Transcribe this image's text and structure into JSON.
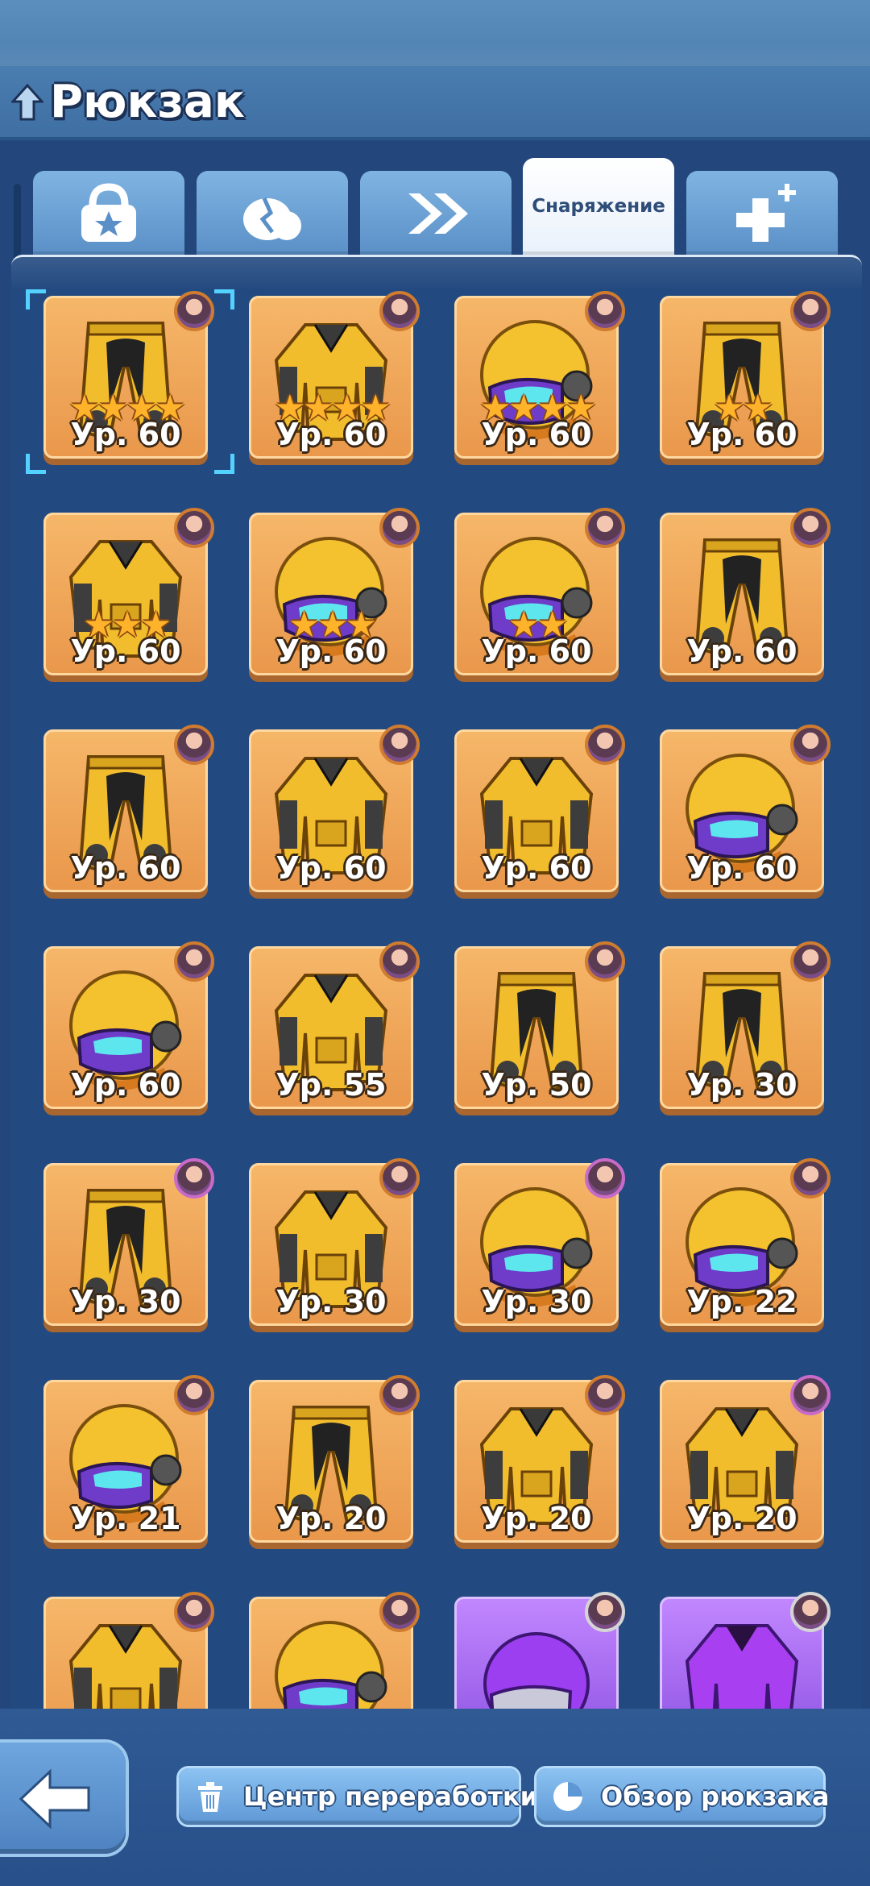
{
  "header": {
    "title": "Рюкзак",
    "icon": "up-arrow-icon"
  },
  "tabs": [
    {
      "name": "tab-items",
      "icon": "bag-icon"
    },
    {
      "name": "tab-shards",
      "icon": "shard-icon"
    },
    {
      "name": "tab-boost",
      "icon": "double-chevron-icon"
    },
    {
      "name": "tab-equipment",
      "label": "Снаряжение",
      "active": true
    },
    {
      "name": "tab-plus",
      "icon": "plus-icon"
    }
  ],
  "items": [
    {
      "type": "pants",
      "stars": 4,
      "level": "Ур. 60",
      "selected": true
    },
    {
      "type": "jacket",
      "stars": 4,
      "level": "Ур. 60"
    },
    {
      "type": "helmet",
      "stars": 4,
      "level": "Ур. 60"
    },
    {
      "type": "pants",
      "stars": 2,
      "level": "Ур. 60"
    },
    {
      "type": "jacket",
      "stars": 3,
      "level": "Ур. 60"
    },
    {
      "type": "helmet",
      "stars": 3,
      "level": "Ур. 60"
    },
    {
      "type": "helmet",
      "stars": 2,
      "level": "Ур. 60"
    },
    {
      "type": "pants",
      "stars": 0,
      "level": "Ур. 60"
    },
    {
      "type": "pants",
      "stars": 0,
      "level": "Ур. 60"
    },
    {
      "type": "jacket",
      "stars": 0,
      "level": "Ур. 60"
    },
    {
      "type": "jacket",
      "stars": 0,
      "level": "Ур. 60"
    },
    {
      "type": "helmet",
      "stars": 0,
      "level": "Ур. 60"
    },
    {
      "type": "helmet",
      "stars": 0,
      "level": "Ур. 60"
    },
    {
      "type": "jacket",
      "stars": 0,
      "level": "Ур. 55"
    },
    {
      "type": "pants",
      "stars": 0,
      "level": "Ур. 50"
    },
    {
      "type": "pants",
      "stars": 0,
      "level": "Ур. 30"
    },
    {
      "type": "pants",
      "stars": 0,
      "level": "Ур. 30",
      "avatar": "pink"
    },
    {
      "type": "jacket",
      "stars": 0,
      "level": "Ур. 30"
    },
    {
      "type": "helmet",
      "stars": 0,
      "level": "Ур. 30",
      "avatar": "pink"
    },
    {
      "type": "helmet",
      "stars": 0,
      "level": "Ур. 22"
    },
    {
      "type": "helmet",
      "stars": 0,
      "level": "Ур. 21"
    },
    {
      "type": "pants",
      "stars": 0,
      "level": "Ур. 20"
    },
    {
      "type": "jacket",
      "stars": 0,
      "level": "Ур. 20"
    },
    {
      "type": "jacket",
      "stars": 0,
      "level": "Ур. 20",
      "avatar": "pink"
    },
    {
      "type": "jacket",
      "stars": 0,
      "level": ""
    },
    {
      "type": "helmet",
      "stars": 0,
      "level": ""
    },
    {
      "type": "helmet",
      "stars": 0,
      "level": "",
      "rarity": "purple",
      "avatar": "white"
    },
    {
      "type": "jacket",
      "stars": 0,
      "level": "",
      "rarity": "purple",
      "avatar": "white"
    }
  ],
  "bottom": {
    "back_icon": "back-arrow-icon",
    "recycle_label": "Центр переработки",
    "recycle_icon": "trash-icon",
    "overview_label": "Обзор рюкзака",
    "overview_icon": "pie-chart-icon"
  },
  "colors": {
    "gold_card": "#f0a857",
    "purple_card": "#9a5be8",
    "background": "#23477c"
  }
}
